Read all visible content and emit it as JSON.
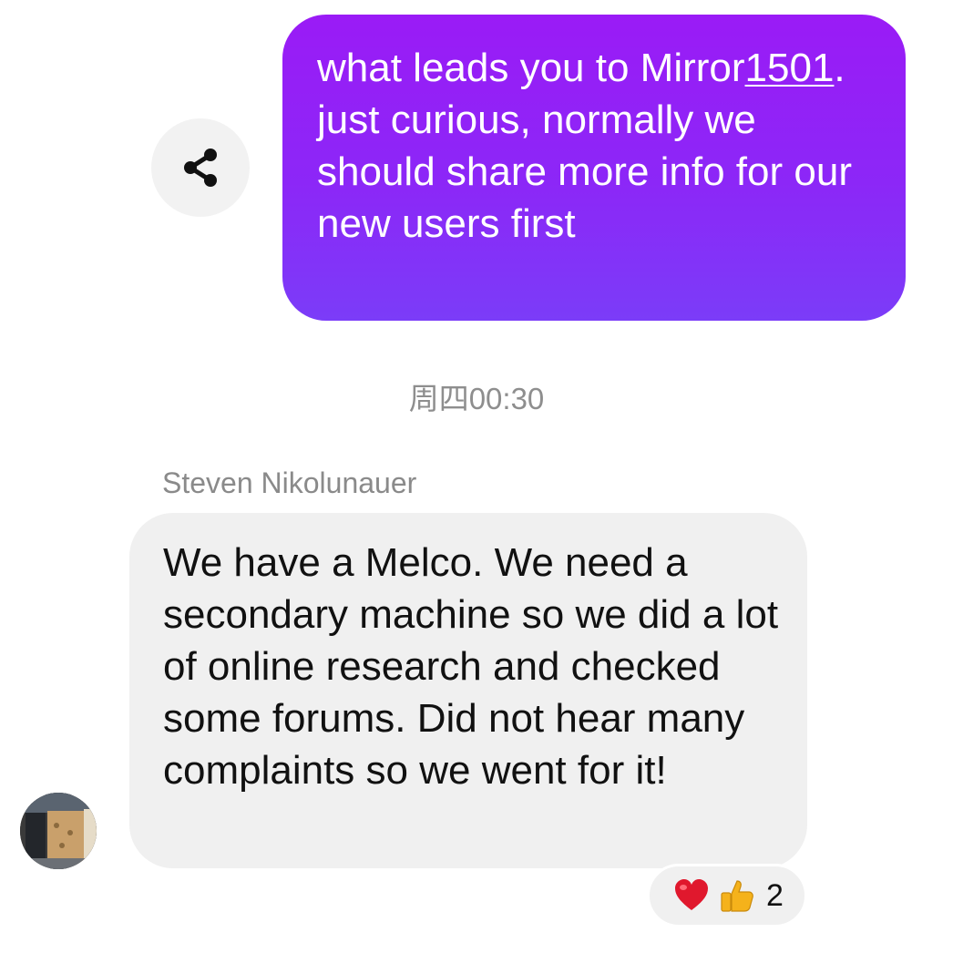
{
  "outgoing_message": {
    "text_before": "what leads you to Mirror",
    "link_text": "1501",
    "text_after": ". just curious, normally we should share more info for our new users first"
  },
  "share_button": {
    "icon": "share-icon"
  },
  "timestamp": "周四00:30",
  "incoming_message": {
    "sender": "Steven Nikolunauer",
    "text": "We have a Melco. We need a secondary machine so we did a lot of online research and checked some forums. Did not hear many complaints so we went for it!"
  },
  "reactions": {
    "emojis": [
      "heart",
      "thumbs-up"
    ],
    "count": "2"
  },
  "colors": {
    "outgoing_bubble_top": "#9a1bf6",
    "outgoing_bubble_bottom": "#7b3cf8",
    "incoming_bubble": "#f0f0f0",
    "heart": "#e0182d",
    "thumbs_up": "#f5b21b"
  }
}
